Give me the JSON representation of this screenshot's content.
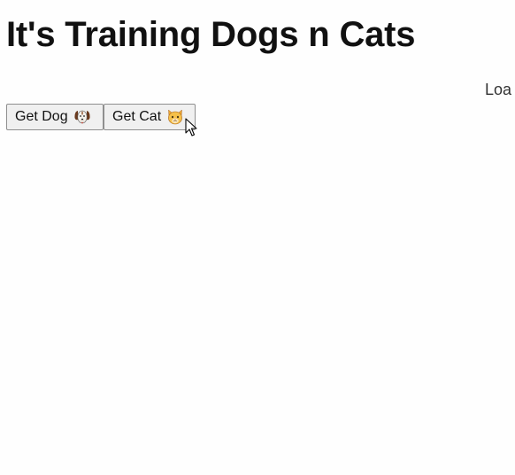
{
  "page": {
    "title": "It's Training Dogs n Cats",
    "status": "Loa"
  },
  "buttons": {
    "dog_label": "Get Dog",
    "dog_icon": "dog-face-icon",
    "cat_label": "Get Cat",
    "cat_icon": "cat-face-icon"
  }
}
